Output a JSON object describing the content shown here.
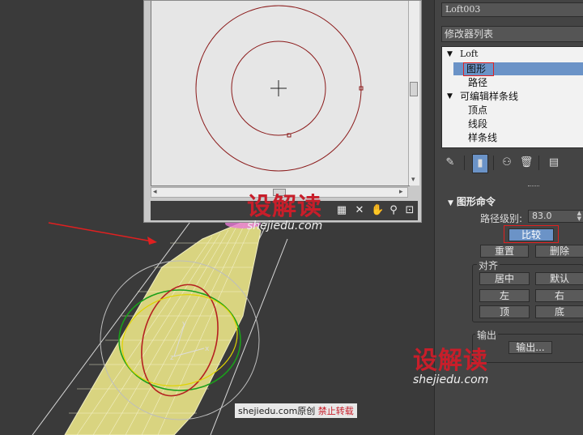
{
  "compare_window": {
    "toolbar_icons": [
      "pick-shape-icon",
      "reset-icon",
      "pan-icon",
      "zoom-icon",
      "zoom-extents-icon"
    ]
  },
  "watermark": {
    "logo": "设解读",
    "url": "shejiedu.com"
  },
  "credit": {
    "site": "shejiedu.com",
    "original": "原创",
    "warning": "禁止转载"
  },
  "panel": {
    "object_name": "Loft003",
    "modifier_list_label": "修改器列表",
    "stack": {
      "loft": "Loft",
      "shape": "图形",
      "path": "路径",
      "editable_spline": "可编辑样条线",
      "vertex": "顶点",
      "segment": "线段",
      "spline": "样条线"
    },
    "rollout": {
      "title": "图形命令",
      "path_level_label": "路径级别:",
      "path_level_value": "83.0",
      "compare": "比较",
      "reset": "重置",
      "delete": "删除",
      "align_group": "对齐",
      "center": "居中",
      "default": "默认",
      "left": "左",
      "right": "右",
      "top": "顶",
      "bottom": "底",
      "output_group": "输出",
      "output_button": "输出..."
    }
  },
  "colors": {
    "selection": "#6b93c7",
    "highlight": "#e02020",
    "shape_curve": "#8b1a1a",
    "loft_mesh": "#e8e4a0"
  }
}
